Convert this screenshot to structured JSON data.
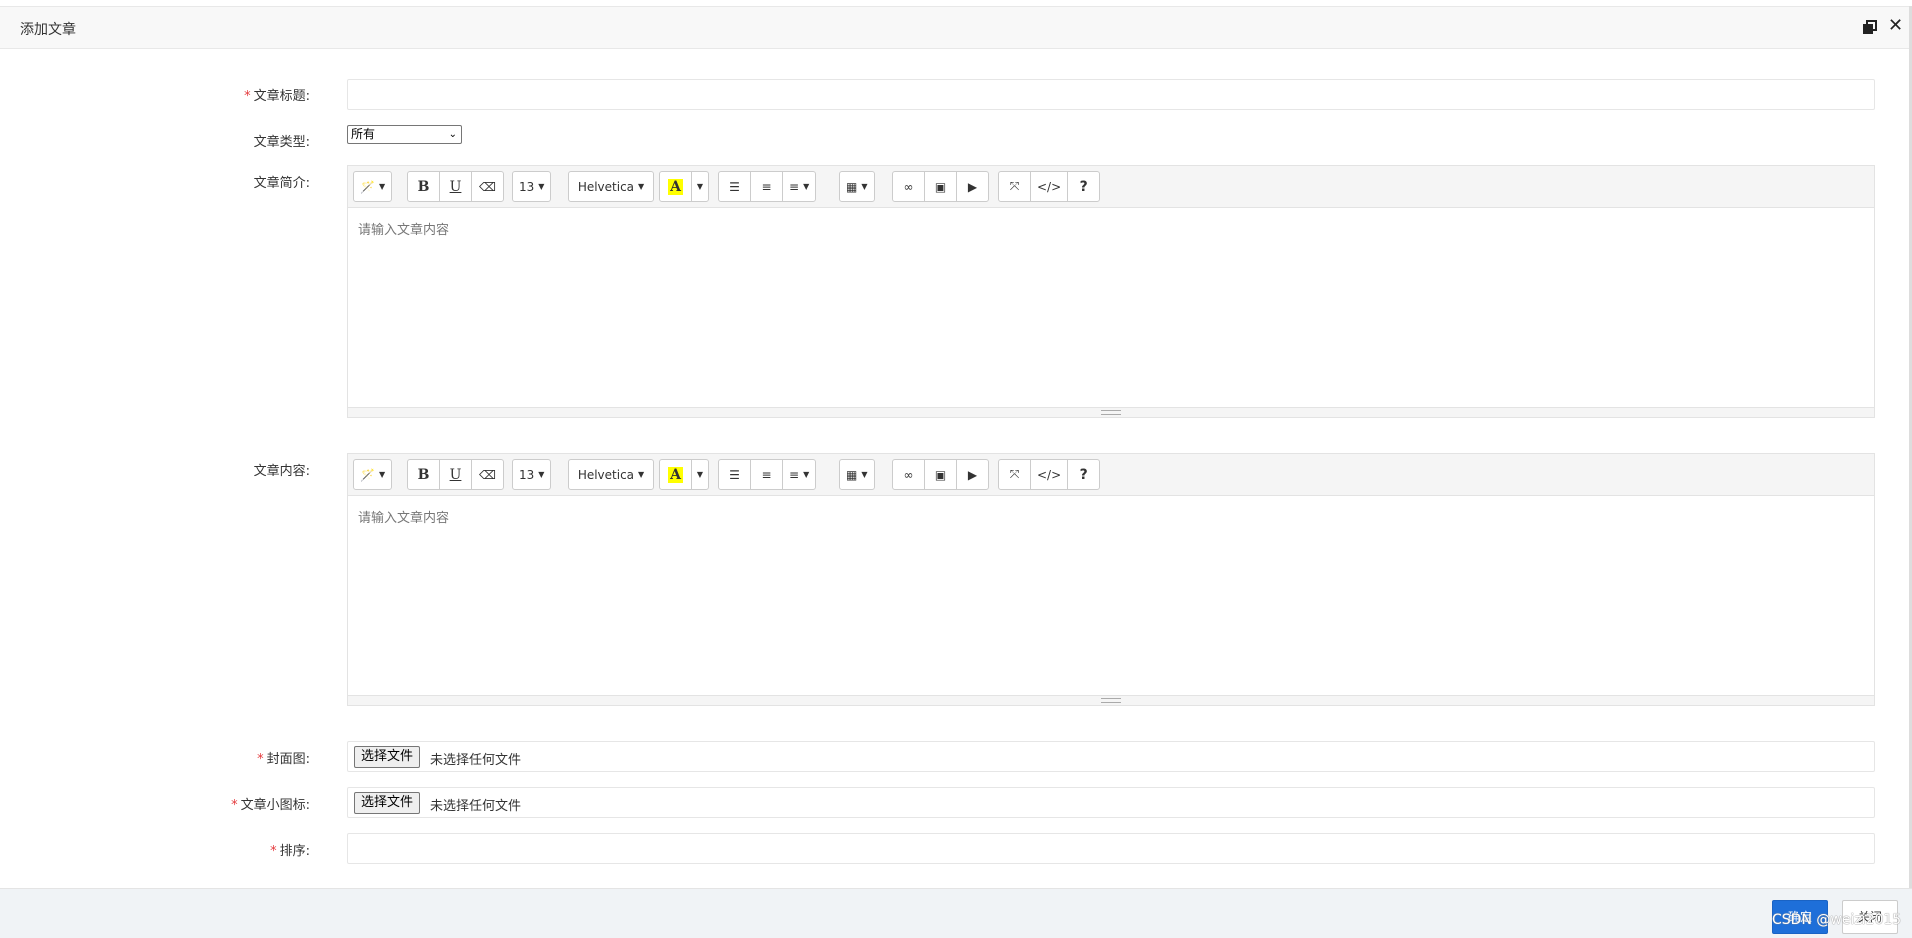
{
  "dialog": {
    "title": "添加文章"
  },
  "form": {
    "title_label": "文章标题:",
    "type_label": "文章类型:",
    "type_selected": "所有",
    "summary_label": "文章简介:",
    "content_label": "文章内容:",
    "cover_label": "封面图:",
    "icon_label": "文章小图标:",
    "sort_label": "排序:",
    "required_mark": "*"
  },
  "editor": {
    "placeholder": "请输入文章内容",
    "font_size": "13",
    "font_family": "Helvetica",
    "bold": "B",
    "underline": "U",
    "color_letter": "A",
    "help": "?",
    "code": "</>"
  },
  "file_input": {
    "button_label": "选择文件",
    "status": "未选择任何文件"
  },
  "footer": {
    "ok_label": "确定",
    "close_label": "关闭"
  },
  "watermark": "CSDN @weizi2015",
  "colors": {
    "primary": "#1e6fd9",
    "required": "#e4393c",
    "highlight": "#ffff00"
  },
  "icons": [
    "magic-wand-icon",
    "eraser-icon",
    "unordered-list-icon",
    "ordered-list-icon",
    "align-icon",
    "table-icon",
    "link-icon",
    "picture-icon",
    "video-icon",
    "fullscreen-icon",
    "code-view-icon",
    "help-icon",
    "restore-icon",
    "close-icon"
  ]
}
